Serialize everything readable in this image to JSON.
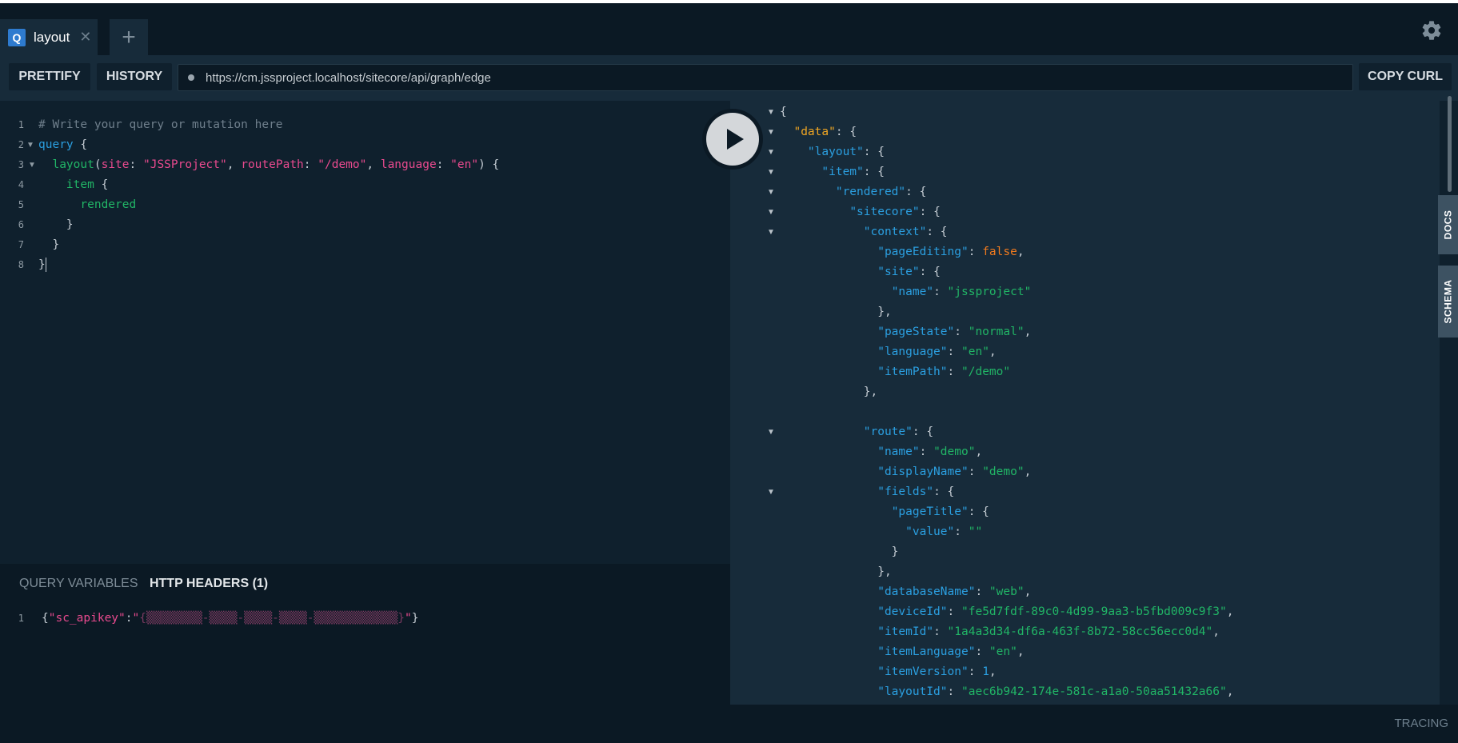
{
  "tab": {
    "badge": "Q",
    "title": "layout",
    "close": "✕",
    "add": "+"
  },
  "toolbar": {
    "prettify": "PRETTIFY",
    "history": "HISTORY",
    "url": "https://cm.jssproject.localhost/sitecore/api/graph/edge",
    "copy_curl": "COPY CURL"
  },
  "query_lines": [
    "# Write your query or mutation here",
    "query {",
    "  layout(site: \"JSSProject\", routePath: \"/demo\", language: \"en\") {",
    "    item {",
    "      rendered",
    "    }",
    "  }",
    "}"
  ],
  "query_tokens": {
    "comment": "# Write your query or mutation here",
    "query_kw": "query",
    "layout": "layout",
    "site_arg": "site",
    "site_val": "\"JSSProject\"",
    "route_arg": "routePath",
    "route_val": "\"/demo\"",
    "lang_arg": "language",
    "lang_val": "\"en\"",
    "item": "item",
    "rendered": "rendered"
  },
  "vars": {
    "query_variables": "QUERY VARIABLES",
    "http_headers": "HTTP HEADERS (1)",
    "header_key": "\"sc_apikey\"",
    "header_value_masked": "{▒▒▒▒▒▒▒▒-▒▒▒▒-▒▒▒▒-▒▒▒▒-▒▒▒▒▒▒▒▒▒▒▒▒}"
  },
  "result": {
    "pageEditing": "false",
    "site_name": "\"jssproject\"",
    "pageState": "\"normal\"",
    "language": "\"en\"",
    "itemPath": "\"/demo\"",
    "route_name": "\"demo\"",
    "displayName": "\"demo\"",
    "pageTitle_value": "\"\"",
    "databaseName": "\"web\"",
    "deviceId": "\"fe5d7fdf-89c0-4d99-9aa3-b5fbd009c9f3\"",
    "itemId": "\"1a4a3d34-df6a-463f-8b72-58cc56ecc0d4\"",
    "itemLanguage": "\"en\"",
    "itemVersion": "1",
    "layoutId": "\"aec6b942-174e-581c-a1a0-50aa51432a66\""
  },
  "side_tabs": {
    "docs": "DOCS",
    "schema": "SCHEMA"
  },
  "footer": {
    "tracing": "TRACING"
  }
}
